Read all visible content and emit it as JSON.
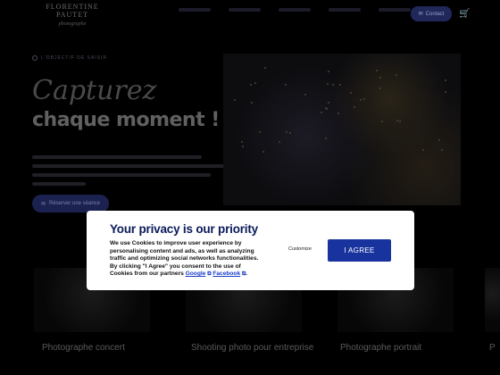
{
  "header": {
    "logo_name": "FLORENTINE PAUTET",
    "logo_sub": "photographe",
    "contact_label": "Contact",
    "cart_icon": "cart-icon"
  },
  "hero": {
    "eyebrow": "L'OBJECTIF DE SAISIR",
    "script_title": "Capturez",
    "title": "chaque moment !",
    "button_label": "Réserver une séance"
  },
  "tiles": [
    {
      "label": "Photographe concert"
    },
    {
      "label": "Shooting photo pour entreprise"
    },
    {
      "label": "Photographe portrait"
    },
    {
      "label": "P"
    }
  ],
  "privacy": {
    "title": "Your privacy is our priority",
    "body_prefix": "We use Cookies to improve user experience by personalising content and ads, as well as analyzing traffic and optimizing social networks functionalities. By clicking \"I Agree\" you consent to the use of Cookies from our partners ",
    "link_google": "Google",
    "link_facebook": "Facebook",
    "body_suffix": ".",
    "customize_label": "Customize",
    "agree_label": "I AGREE"
  },
  "colors": {
    "agree_button": "#18339e",
    "title": "#0a1a5a",
    "link": "#1a3cc8"
  }
}
